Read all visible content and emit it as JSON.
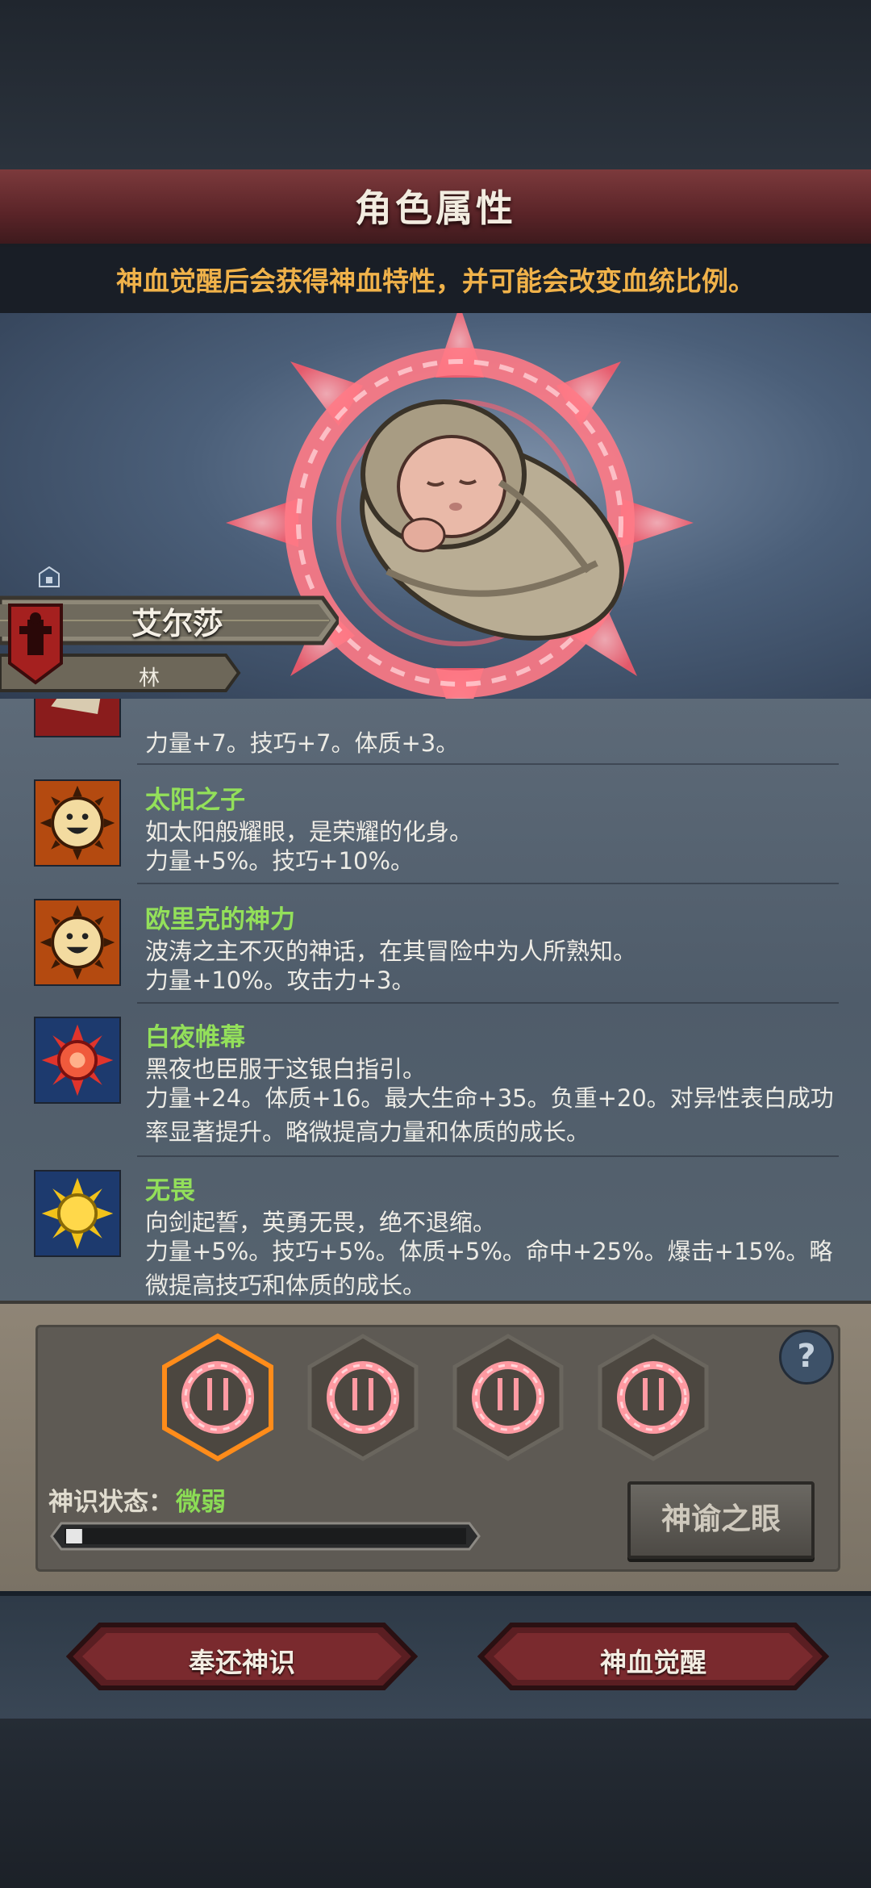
{
  "header": {
    "title": "角色属性",
    "hint": "神血觉醒后会获得神血特性，并可能会改变血统比例。"
  },
  "character": {
    "name": "艾尔莎",
    "subname": "林"
  },
  "traits": [
    {
      "name": "",
      "desc": "",
      "stats": "力量+7。技巧+7。体质+3。",
      "icon": "red-crest-icon"
    },
    {
      "name": "太阳之子",
      "desc": "如太阳般耀眼，是荣耀的化身。",
      "stats": "力量+5%。技巧+10%。",
      "icon": "smiley-sun-icon"
    },
    {
      "name": "欧里克的神力",
      "desc": "波涛之主不灭的神话，在其冒险中为人所熟知。",
      "stats": "力量+10%。攻击力+3。",
      "icon": "smiley-sun-icon"
    },
    {
      "name": "白夜帷幕",
      "desc": "黑夜也臣服于这银白指引。",
      "stats": "力量+24。体质+16。最大生命+35。负重+20。对异性表白成功率显著提升。略微提高力量和体质的成长。",
      "icon": "red-sun-icon"
    },
    {
      "name": "无畏",
      "desc": "向剑起誓，英勇无畏，绝不退缩。",
      "stats": "力量+5%。技巧+5%。体质+5%。命中+25%。爆击+15%。略微提高技巧和体质的成长。",
      "icon": "yellow-sun-icon"
    }
  ],
  "panel": {
    "slots_total": 4,
    "selected_slot": 1,
    "help": "?",
    "status_label": "神识状态：",
    "status_value": "微弱",
    "progress": 0.04,
    "oracle_button": "神谕之眼"
  },
  "actions": {
    "return_label": "奉还神识",
    "awaken_label": "神血觉醒"
  },
  "colors": {
    "accent_orange": "#f0b24a",
    "trait_green": "#93e05a",
    "title_red": "#5a2428"
  }
}
